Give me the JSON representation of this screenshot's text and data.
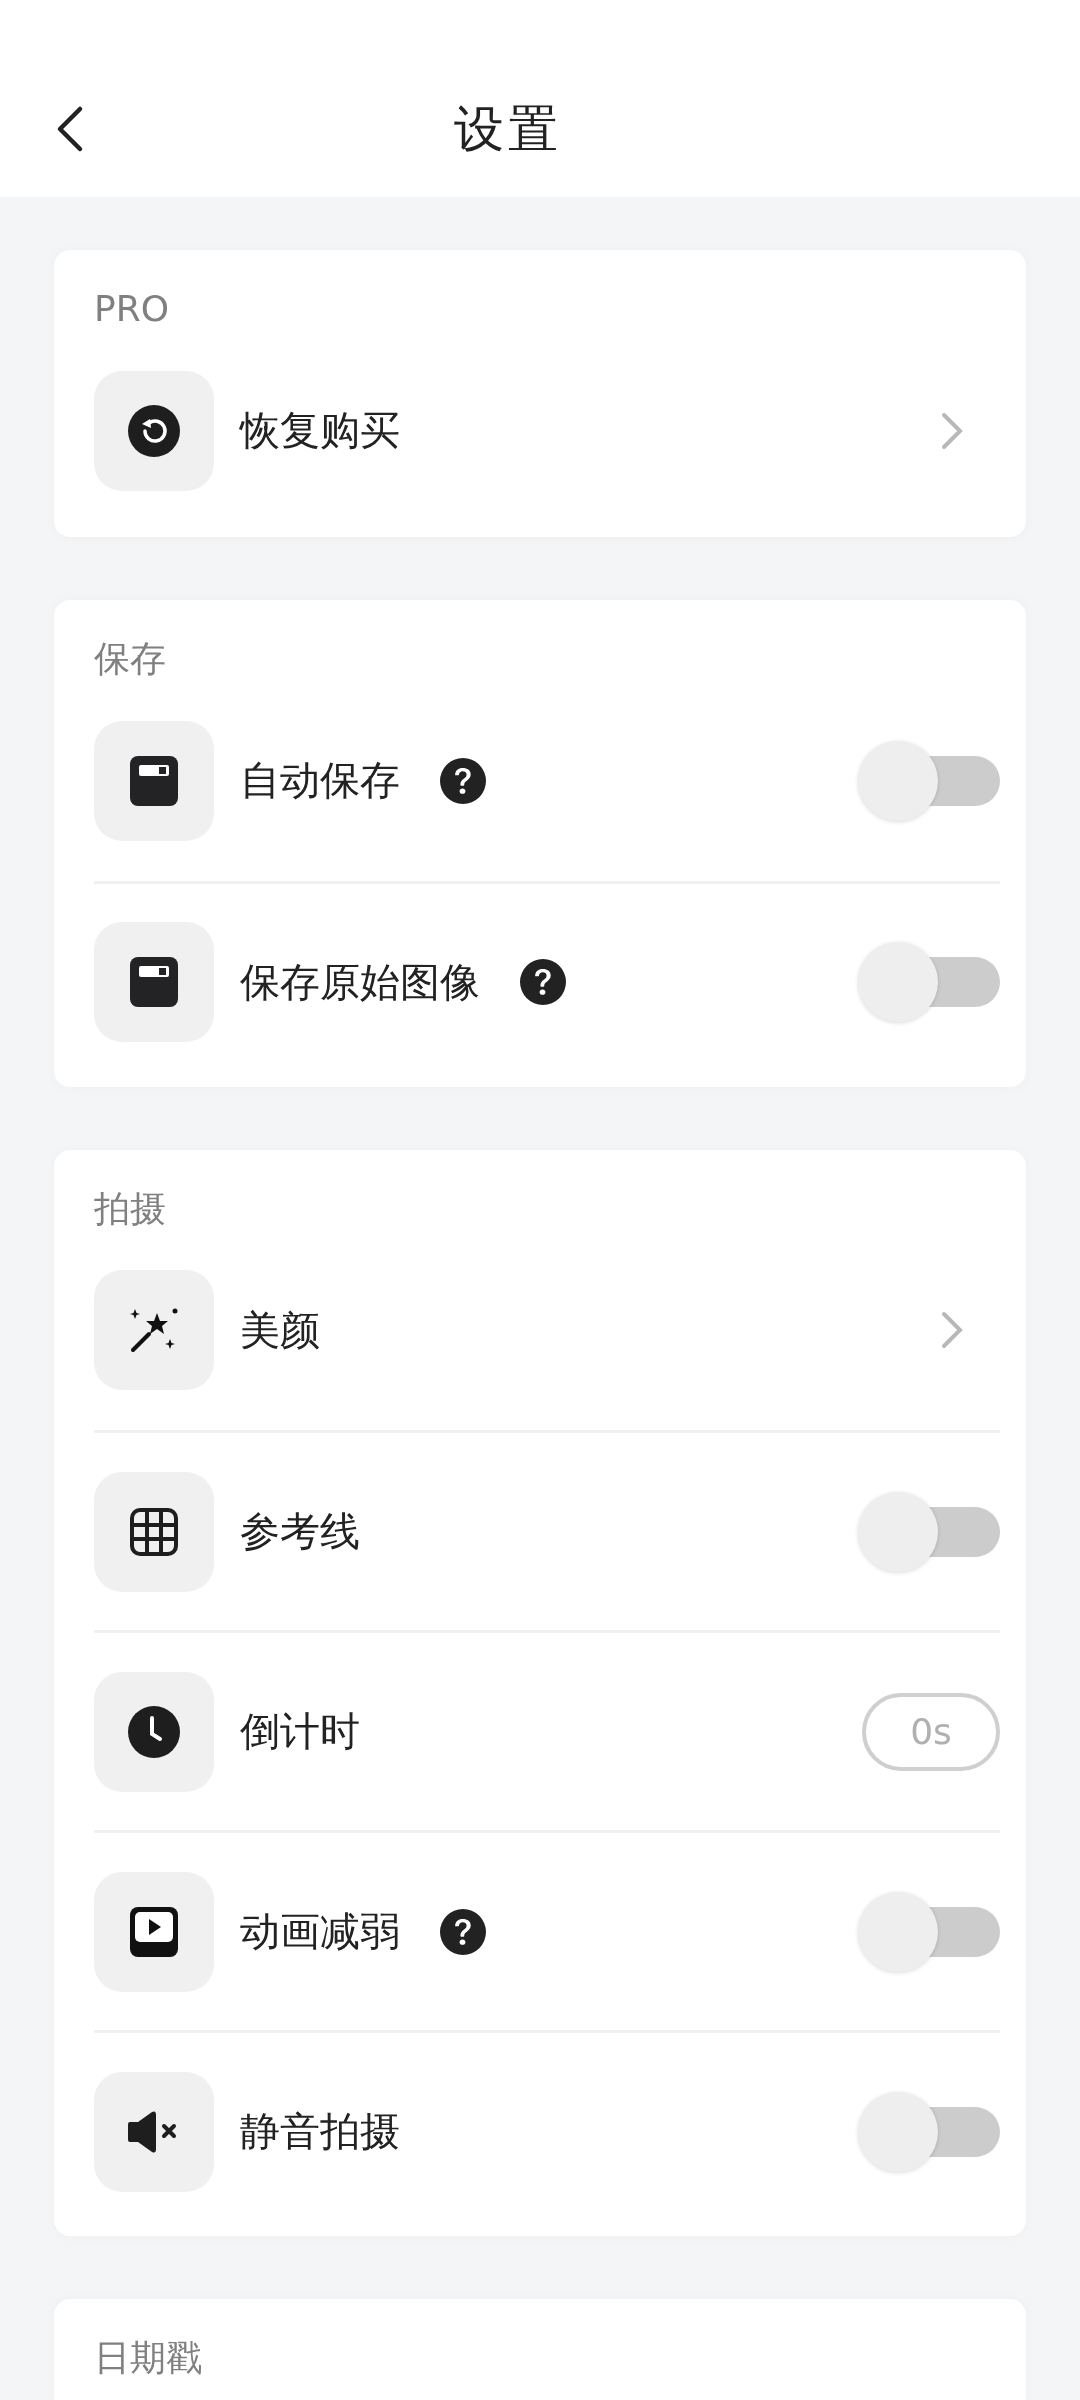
{
  "header": {
    "title": "设置"
  },
  "sections": [
    {
      "title": "PRO",
      "rows": [
        {
          "kind": "chevron",
          "label": "恢复购买"
        }
      ]
    },
    {
      "title": "保存",
      "rows": [
        {
          "kind": "toggle",
          "label": "自动保存",
          "help": true,
          "on": false
        },
        {
          "kind": "toggle",
          "label": "保存原始图像",
          "help": true,
          "on": false
        }
      ]
    },
    {
      "title": "拍摄",
      "rows": [
        {
          "kind": "chevron",
          "label": "美颜"
        },
        {
          "kind": "toggle",
          "label": "参考线",
          "on": false
        },
        {
          "kind": "value",
          "label": "倒计时",
          "value": "0s"
        },
        {
          "kind": "toggle",
          "label": "动画减弱",
          "help": true,
          "on": false
        },
        {
          "kind": "toggle",
          "label": "静音拍摄",
          "on": false
        }
      ]
    },
    {
      "title": "日期戳"
    }
  ]
}
